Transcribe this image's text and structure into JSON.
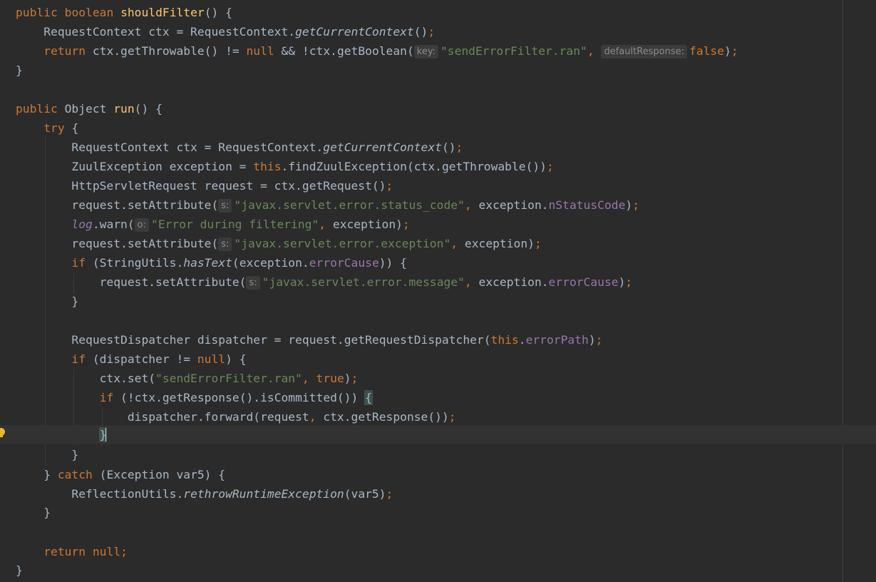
{
  "editor": {
    "language": "java",
    "caret_line": 23,
    "colors": {
      "background": "#2b2b2b",
      "keyword": "#cc7832",
      "method_declaration": "#ffc66d",
      "string": "#6a8759",
      "field": "#9876aa",
      "plain": "#a9b7c6",
      "inlay_hint": "#8c8c8c",
      "intention_bulb": "#e8b832"
    },
    "icons": {
      "gutter": "intention-bulb-icon"
    },
    "inlay_hints": {
      "key": "key:",
      "default_response": "defaultResponse:",
      "s": "s:",
      "o": "o:"
    },
    "lines": [
      "public boolean shouldFilter() {",
      "    RequestContext ctx = RequestContext.getCurrentContext();",
      "    return ctx.getThrowable() != null && !ctx.getBoolean(\"sendErrorFilter.ran\", false);",
      "}",
      "",
      "public Object run() {",
      "    try {",
      "        RequestContext ctx = RequestContext.getCurrentContext();",
      "        ZuulException exception = this.findZuulException(ctx.getThrowable());",
      "        HttpServletRequest request = ctx.getRequest();",
      "        request.setAttribute(\"javax.servlet.error.status_code\", exception.nStatusCode);",
      "        log.warn(\"Error during filtering\", exception);",
      "        request.setAttribute(\"javax.servlet.error.exception\", exception);",
      "        if (StringUtils.hasText(exception.errorCause)) {",
      "            request.setAttribute(\"javax.servlet.error.message\", exception.errorCause);",
      "        }",
      "",
      "        RequestDispatcher dispatcher = request.getRequestDispatcher(this.errorPath);",
      "        if (dispatcher != null) {",
      "            ctx.set(\"sendErrorFilter.ran\", true);",
      "            if (!ctx.getResponse().isCommitted()) {",
      "                dispatcher.forward(request, ctx.getResponse());",
      "            }",
      "        }",
      "    } catch (Exception var5) {",
      "        ReflectionUtils.rethrowRuntimeException(var5);",
      "    }",
      "",
      "    return null;",
      "}"
    ],
    "tokens": {
      "kw_public": "public",
      "kw_boolean": "boolean",
      "kw_return": "return",
      "kw_null": "null",
      "kw_try": "try",
      "kw_this": "this",
      "kw_if": "if",
      "kw_true": "true",
      "kw_false": "false",
      "kw_catch": "catch",
      "fn_shouldFilter": "shouldFilter",
      "fn_run": "run",
      "m_getCurrentContext": "getCurrentContext",
      "m_hasText": "hasText",
      "m_rethrow": "rethrowRuntimeException",
      "f_log": "log",
      "f_nStatusCode": "nStatusCode",
      "f_errorCause": "errorCause",
      "f_errorPath": "errorPath",
      "s_sendErrorFilterRan": "\"sendErrorFilter.ran\"",
      "s_statusCode": "\"javax.servlet.error.status_code\"",
      "s_errorDuringFiltering": "\"Error during filtering\"",
      "s_exception": "\"javax.servlet.error.exception\"",
      "s_message": "\"javax.servlet.error.message\""
    }
  }
}
